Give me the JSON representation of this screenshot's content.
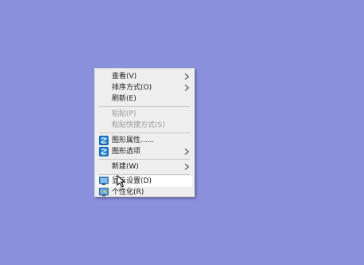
{
  "desktop": {
    "background": "#8b90dc"
  },
  "context_menu": {
    "items": [
      {
        "label": "查看(V)",
        "submenu": true,
        "disabled": false
      },
      {
        "label": "排序方式(O)",
        "submenu": true,
        "disabled": false
      },
      {
        "label": "刷新(E)",
        "submenu": false,
        "disabled": false
      },
      {
        "label": "粘贴(P)",
        "submenu": false,
        "disabled": true
      },
      {
        "label": "粘贴快捷方式(S)",
        "submenu": false,
        "disabled": true
      },
      {
        "label": "图形属性......",
        "submenu": false,
        "disabled": false,
        "icon": "intel-graphics-icon"
      },
      {
        "label": "图形选项",
        "submenu": true,
        "disabled": false,
        "icon": "intel-graphics-icon"
      },
      {
        "label": "新建(W)",
        "submenu": true,
        "disabled": false
      },
      {
        "label": "显示设置(D)",
        "submenu": false,
        "disabled": false,
        "icon": "display-settings-icon",
        "hovered": true
      },
      {
        "label": "个性化(R)",
        "submenu": false,
        "disabled": false,
        "icon": "personalize-icon"
      }
    ]
  }
}
